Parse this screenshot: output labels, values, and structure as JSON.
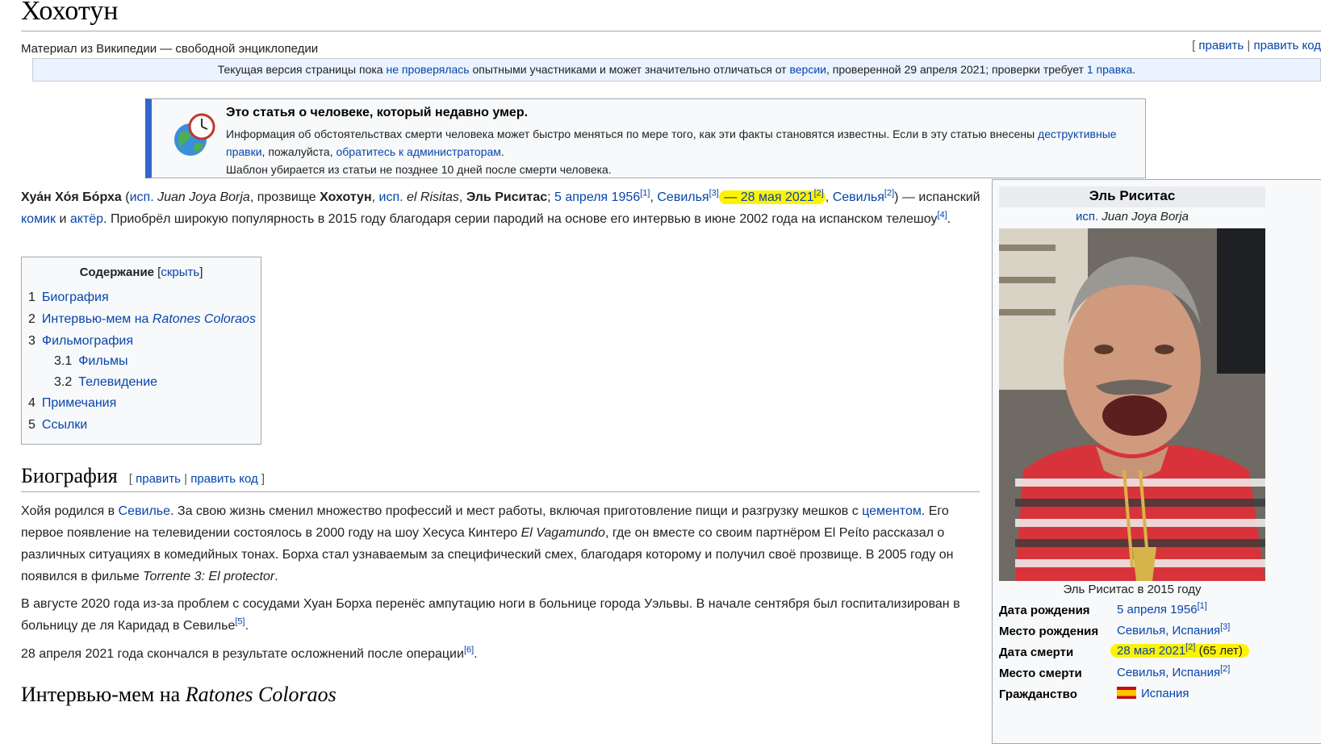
{
  "title": "Хохотун",
  "tagline": "Материал из Википедии — свободной энциклопедии",
  "edit_links": {
    "open": "[ ",
    "edit": "править",
    "sep": " | ",
    "edit_source": "править код"
  },
  "flagged": {
    "t1": "Текущая версия страницы пока ",
    "l1": "не проверялась",
    "t2": " опытными участниками и может значительно отличаться от ",
    "l2": "версии",
    "t3": ", проверенной 29 апреля 2021; проверки требует ",
    "l3": "1 правка",
    "t4": "."
  },
  "death_notice": {
    "title": "Это статья о человеке, который недавно умер.",
    "t1": "Информация об обстоятельствах смерти человека может быстро меняться по мере того, как эти факты становятся известны. Если в эту статью внесены ",
    "l1": "деструктивные правки",
    "t2": ", пожалуйста, ",
    "l2": "обратитесь к администраторам",
    "t3": ".",
    "t4": "Шаблон убирается из статьи не позднее 10 дней после смерти человека.",
    "icon": "clock-globe-icon"
  },
  "lead": {
    "name": "Хуа́н Хо́я Бо́рха",
    "t1": " (",
    "l_isp": "исп.",
    "native": " Juan Joya Borja",
    "t2": ", прозвище ",
    "nick": "Хохотун",
    "t3": ", ",
    "l_isp2": "исп.",
    "nick_es": " el Risitas",
    "t4": ", ",
    "nick2": "Эль Риситас",
    "t5": "; ",
    "birth_date": "5 апреля 1956",
    "ref1": "[1]",
    "t6": ", ",
    "birth_place": "Севилья",
    "ref3": "[3]",
    "t7": " — ",
    "death_date": "28 мая 2021",
    "ref2": "[2]",
    "t8": ", ",
    "death_place": "Севилья",
    "ref2b": "[2]",
    "t9": ") — испанский ",
    "l_comic": "комик",
    "t10": " и ",
    "l_actor": "актёр",
    "t11": ". Приобрёл широкую популярность в 2015 году благодаря серии пародий на основе его интервью в июне 2002 года на испанском телешоу",
    "ref4": "[4]",
    "t12": "."
  },
  "toc": {
    "title": "Содержание",
    "hide_open": " [",
    "hide": "скрыть",
    "hide_close": "]",
    "items": [
      {
        "num": "1",
        "label": "Биография"
      },
      {
        "num": "2",
        "label": "Интервью-мем на ",
        "label_i": "Ratones Coloraos"
      },
      {
        "num": "3",
        "label": "Фильмография"
      },
      {
        "num": "3.1",
        "label": "Фильмы"
      },
      {
        "num": "3.2",
        "label": "Телевидение"
      },
      {
        "num": "4",
        "label": "Примечания"
      },
      {
        "num": "5",
        "label": "Ссылки"
      }
    ]
  },
  "bio": {
    "heading": "Биография",
    "p1_t1": "Хойя родился в ",
    "p1_l1": "Севилье",
    "p1_t2": ". За свою жизнь сменил множество профессий и мест работы, включая приготовление пищи и разгрузку мешков с ",
    "p1_l2": "цементом",
    "p1_t3": ". Его первое появление на телевидении состоялось в 2000 году на шоу Хесуса Кинтеро ",
    "p1_i1": "El Vagamundo",
    "p1_t4": ", где он вместе со своим партнёром El Peíto рассказал о различных ситуациях в комедийных тонах. Борха стал узнаваемым за специфический смех, благодаря которому и получил своё прозвище. В 2005 году он появился в фильме ",
    "p1_i2": "Torrente 3: El protector",
    "p1_t5": ".",
    "p2": "В августе 2020 года из-за проблем с сосудами Хуан Борха перенёс ампутацию ноги в больнице города Уэльвы. В начале сентября был госпитализирован в больницу де ля Каридад в Севилье",
    "p2_ref": "[5]",
    "p2_end": ".",
    "p3": "28 апреля 2021 года скончался в результате осложнений после операции",
    "p3_ref": "[6]",
    "p3_end": "."
  },
  "next_section": {
    "heading": "Интервью-мем на ",
    "heading_i": "Ratones Coloraos"
  },
  "infobox": {
    "name": "Эль Риситас",
    "native_l": "исп.",
    "native": " Juan Joya Borja",
    "caption": "Эль Риситас в 2015 году",
    "rows": [
      {
        "label": "Дата рождения",
        "value": "5 апреля 1956",
        "ref": "[1]",
        "extra": ""
      },
      {
        "label": "Место рождения",
        "value": "Севилья, Испания",
        "ref": "[3]",
        "extra": ""
      },
      {
        "label": "Дата смерти",
        "value": "28 мая 2021",
        "ref": "[2]",
        "extra": " (65 лет)"
      },
      {
        "label": "Место смерти",
        "value": "Севилья, Испания",
        "ref": "[2]",
        "extra": ""
      },
      {
        "label": "Гражданство",
        "value": "Испания",
        "ref": "",
        "extra": ""
      }
    ]
  },
  "colors": {
    "link": "#0645ad",
    "highlight": "#fdf300",
    "notice_accent": "#3366cc"
  }
}
